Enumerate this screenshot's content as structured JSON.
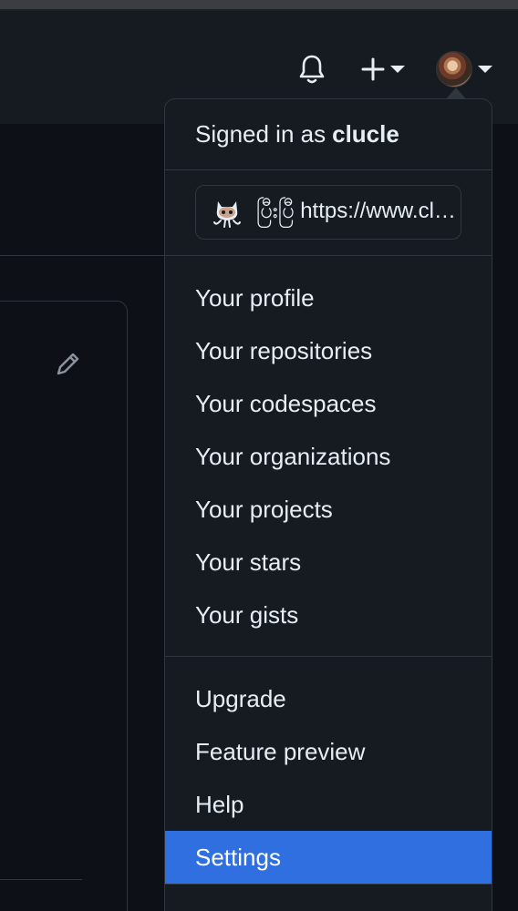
{
  "header": {
    "icons": {
      "notifications": "bell-icon",
      "create": "plus-icon",
      "avatar": "avatar-icon"
    }
  },
  "dropdown": {
    "signed_in_prefix": "Signed in as",
    "username": "clucle",
    "status": {
      "emoji": "octocat-icon",
      "text": "ပြီးပြီ https://www.clucle.kr"
    },
    "group1": [
      {
        "label": "Your profile"
      },
      {
        "label": "Your repositories"
      },
      {
        "label": "Your codespaces"
      },
      {
        "label": "Your organizations"
      },
      {
        "label": "Your projects"
      },
      {
        "label": "Your stars"
      },
      {
        "label": "Your gists"
      }
    ],
    "group2": [
      {
        "label": "Upgrade"
      },
      {
        "label": "Feature preview"
      },
      {
        "label": "Help"
      },
      {
        "label": "Settings",
        "active": true
      }
    ]
  },
  "colors": {
    "accent": "#2f6fe0",
    "background": "#0d1117",
    "surface": "#161b22",
    "border": "#30363d"
  }
}
